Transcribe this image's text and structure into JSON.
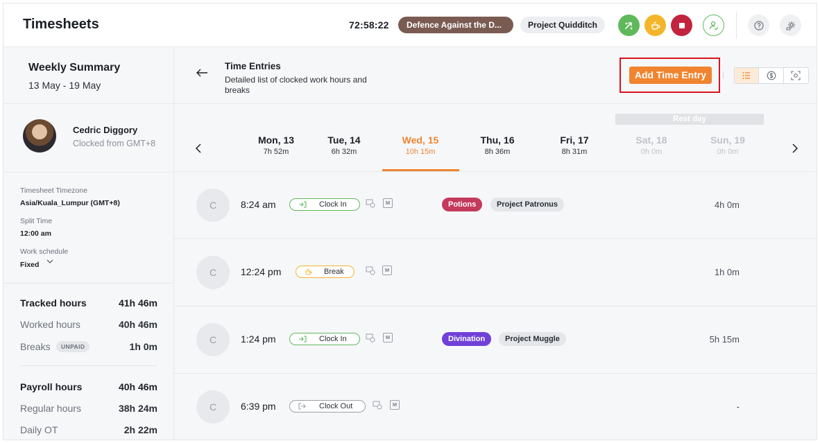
{
  "header": {
    "title": "Timesheets",
    "timer": "72:58:22",
    "current_activity": "Defence Against the D...",
    "current_project": "Project Quidditch",
    "icons": [
      "switch-icon",
      "break-icon",
      "stop-icon",
      "user-check-icon",
      "help-icon",
      "settings-icon"
    ],
    "colors": {
      "switch": "#5fb95a",
      "break": "#f3b52a",
      "stop": "#c2243e",
      "activity": "#7a5b52"
    }
  },
  "sidebar": {
    "week_title": "Weekly Summary",
    "week_range": "13 May - 19 May",
    "user": {
      "name": "Cedric Diggory",
      "sub": "Clocked from GMT+8"
    },
    "timezone_label": "Timesheet Timezone",
    "timezone_value": "Asia/Kuala_Lumpur (GMT+8)",
    "split_label": "Split Time",
    "split_value": "12:00 am",
    "schedule_label": "Work schedule",
    "schedule_value": "Fixed",
    "tracked": {
      "label": "Tracked hours",
      "value": "41h 46m"
    },
    "worked": {
      "label": "Worked hours",
      "value": "40h 46m"
    },
    "breaks": {
      "label": "Breaks",
      "badge": "UNPAID",
      "value": "1h 0m"
    },
    "payroll": {
      "label": "Payroll hours",
      "value": "40h 46m"
    },
    "regular": {
      "label": "Regular hours",
      "value": "38h 24m"
    },
    "daily_ot": {
      "label": "Daily OT",
      "value": "2h 22m"
    }
  },
  "main": {
    "title": "Time Entries",
    "description": "Detailed list of clocked work hours and breaks",
    "add_button": "Add Time Entry",
    "accent": "#f0842f",
    "rest_label": "Rest day",
    "days": [
      {
        "name": "Mon, 13",
        "hours": "7h 52m"
      },
      {
        "name": "Tue, 14",
        "hours": "6h 32m"
      },
      {
        "name": "Wed, 15",
        "hours": "10h 15m"
      },
      {
        "name": "Thu, 16",
        "hours": "8h 36m"
      },
      {
        "name": "Fri, 17",
        "hours": "8h 31m"
      },
      {
        "name": "Sat, 18",
        "hours": "0h 0m"
      },
      {
        "name": "Sun, 19",
        "hours": "0h 0m"
      }
    ],
    "entries": [
      {
        "avatar": "C",
        "time": "8:24 am",
        "type": "Clock In",
        "device_badge": "M",
        "activity": "Potions",
        "project": "Project Patronus",
        "duration": "4h 0m"
      },
      {
        "avatar": "C",
        "time": "12:24 pm",
        "type": "Break",
        "device_badge": "M",
        "duration": "1h 0m"
      },
      {
        "avatar": "C",
        "time": "1:24 pm",
        "type": "Clock In",
        "device_badge": "M",
        "activity": "Divination",
        "project": "Project Muggle",
        "duration": "5h 15m"
      },
      {
        "avatar": "C",
        "time": "6:39 pm",
        "type": "Clock Out",
        "device_badge": "M",
        "duration": "-"
      }
    ]
  }
}
